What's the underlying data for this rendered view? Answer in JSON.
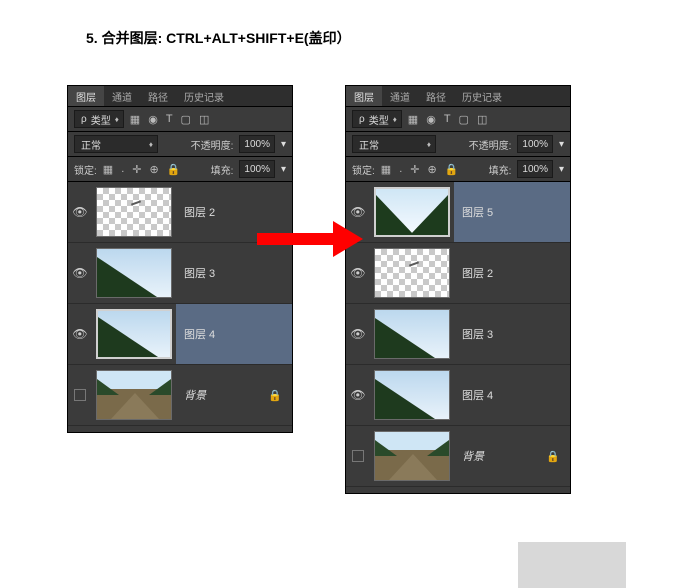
{
  "title": "5. 合并图层: CTRL+ALT+SHIFT+E(盖印）",
  "panel": {
    "tabs": {
      "layers": "图层",
      "channels": "通道",
      "paths": "路径",
      "history": "历史记录"
    },
    "filter": {
      "prefix": "ρ",
      "value": "类型"
    },
    "iconrow": [
      "▦",
      "◉",
      "T",
      "▢",
      "◫"
    ],
    "blend": {
      "value": "正常"
    },
    "opacity": {
      "label": "不透明度:",
      "value": "100%"
    },
    "lockrow": {
      "label": "锁定:",
      "icons": [
        "▦",
        ".",
        "✛",
        "⊕",
        "🔒"
      ],
      "fill_label": "填充:",
      "fill_value": "100%"
    }
  },
  "left_layers": [
    {
      "name": "图层 2",
      "visible": true,
      "selected": false,
      "kind": "tinydash"
    },
    {
      "name": "图层 3",
      "visible": true,
      "selected": false,
      "kind": "skywedge"
    },
    {
      "name": "图层 4",
      "visible": true,
      "selected": true,
      "kind": "skywedge"
    },
    {
      "name": "背景",
      "visible": false,
      "selected": false,
      "kind": "road",
      "locked": true,
      "italic": true
    }
  ],
  "right_layers": [
    {
      "name": "图层 5",
      "visible": true,
      "selected": true,
      "kind": "merged"
    },
    {
      "name": "图层 2",
      "visible": true,
      "selected": false,
      "kind": "tinydash"
    },
    {
      "name": "图层 3",
      "visible": true,
      "selected": false,
      "kind": "skywedge"
    },
    {
      "name": "图层 4",
      "visible": true,
      "selected": false,
      "kind": "skywedge"
    },
    {
      "name": "背景",
      "visible": false,
      "selected": false,
      "kind": "road",
      "locked": true,
      "italic": true
    }
  ]
}
